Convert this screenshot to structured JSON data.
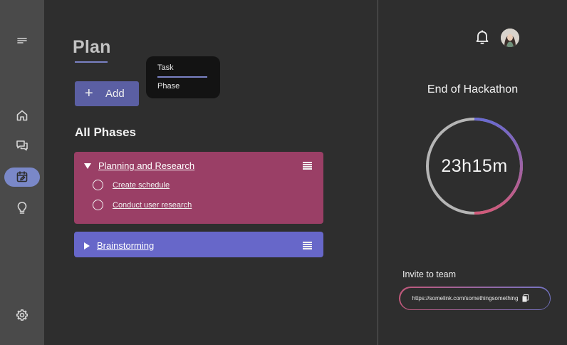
{
  "sidebar": {
    "items": [
      {
        "icon": "menu-icon"
      },
      {
        "icon": "home-icon"
      },
      {
        "icon": "chat-icon"
      },
      {
        "icon": "calendar-edit-icon",
        "active": true
      },
      {
        "icon": "lightbulb-icon"
      },
      {
        "icon": "settings-icon"
      }
    ],
    "active_color": "#7a88c8"
  },
  "main": {
    "title": "Plan",
    "add_label": "Add",
    "add_dropdown": {
      "options": [
        "Task",
        "Phase"
      ]
    },
    "section_heading": "All Phases",
    "phases": [
      {
        "title": "Planning and Research",
        "expanded": true,
        "color": "#9a3f66",
        "tasks": [
          "Create schedule",
          "Conduct user research"
        ]
      },
      {
        "title": "Brainstorming",
        "expanded": false,
        "color": "#6767c9",
        "tasks": []
      }
    ]
  },
  "right_panel": {
    "countdown_title": "End of Hackathon",
    "countdown_value": "23h15m",
    "invite_label": "Invite to team",
    "invite_url": "https://somelink.com/somethingsomething"
  }
}
